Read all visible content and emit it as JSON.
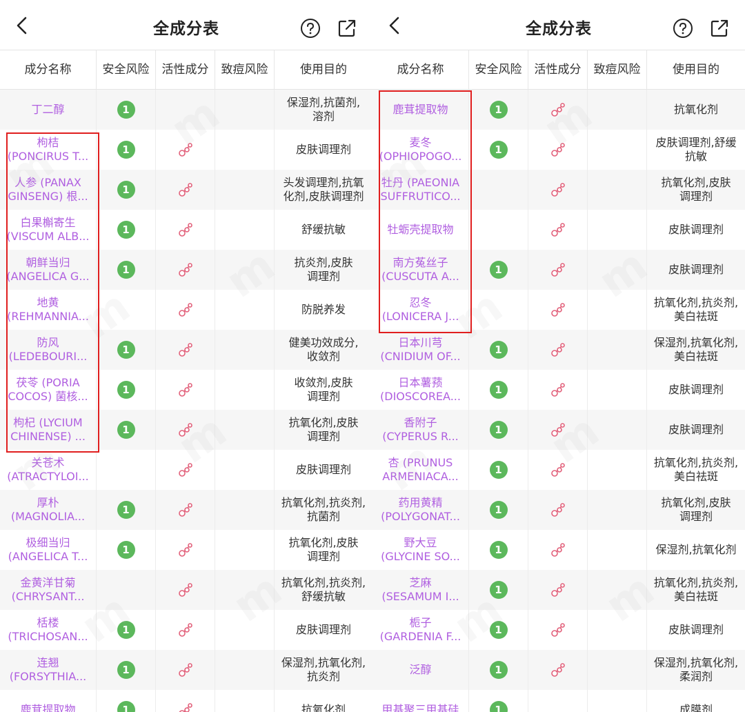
{
  "screen": {
    "title": "全成分表",
    "columns": [
      "成分名称",
      "安全风险",
      "活性成分",
      "致痘风险",
      "使用目的"
    ]
  },
  "colors": {
    "name_text": "#b05fe0",
    "risk_badge": "#5cb85c",
    "highlight": "#e01e1e",
    "active_icon": "#e2607a"
  },
  "icons": {
    "back": "chevron-left-icon",
    "help": "question-circle-icon",
    "share": "share-icon",
    "active": "molecule-icon"
  },
  "panels": [
    {
      "rows": [
        {
          "name": [
            "丁二醇"
          ],
          "risk": "1",
          "active": false,
          "purpose": [
            "保湿剂,抗菌剂,",
            "溶剂"
          ]
        },
        {
          "name": [
            "枸桔",
            "(PONCIRUS T..."
          ],
          "risk": "1",
          "active": true,
          "purpose": [
            "皮肤调理剂"
          ]
        },
        {
          "name": [
            "人参 (PANAX",
            "GINSENG) 根..."
          ],
          "risk": "1",
          "active": true,
          "purpose": [
            "头发调理剂,抗氧",
            "化剂,皮肤调理剂"
          ]
        },
        {
          "name": [
            "白果槲寄生",
            "(VISCUM ALB..."
          ],
          "risk": "1",
          "active": true,
          "purpose": [
            "舒缓抗敏"
          ]
        },
        {
          "name": [
            "朝鲜当归",
            "(ANGELICA G..."
          ],
          "risk": "1",
          "active": true,
          "purpose": [
            "抗炎剂,皮肤",
            "调理剂"
          ]
        },
        {
          "name": [
            "地黄",
            "(REHMANNIA..."
          ],
          "risk": "",
          "active": true,
          "purpose": [
            "防脱养发"
          ]
        },
        {
          "name": [
            "防风",
            "(LEDEBOURI..."
          ],
          "risk": "1",
          "active": true,
          "purpose": [
            "健美功效成分,",
            "收敛剂"
          ]
        },
        {
          "name": [
            "茯苓 (PORIA",
            "COCOS) 菌核..."
          ],
          "risk": "1",
          "active": true,
          "purpose": [
            "收敛剂,皮肤",
            "调理剂"
          ]
        },
        {
          "name": [
            "枸杞 (LYCIUM",
            "CHINENSE) ..."
          ],
          "risk": "1",
          "active": true,
          "purpose": [
            "抗氧化剂,皮肤",
            "调理剂"
          ]
        },
        {
          "name": [
            "关苍术",
            "(ATRACTYLOI..."
          ],
          "risk": "",
          "active": true,
          "purpose": [
            "皮肤调理剂"
          ]
        },
        {
          "name": [
            "厚朴",
            "(MAGNOLIA..."
          ],
          "risk": "1",
          "active": true,
          "purpose": [
            "抗氧化剂,抗炎剂,",
            "抗菌剂"
          ]
        },
        {
          "name": [
            "极细当归",
            "(ANGELICA T..."
          ],
          "risk": "1",
          "active": true,
          "purpose": [
            "抗氧化剂,皮肤",
            "调理剂"
          ]
        },
        {
          "name": [
            "金黄洋甘菊",
            "(CHRYSANT..."
          ],
          "risk": "",
          "active": true,
          "purpose": [
            "抗氧化剂,抗炎剂,",
            "舒缓抗敏"
          ]
        },
        {
          "name": [
            "栝楼",
            "(TRICHOSAN..."
          ],
          "risk": "1",
          "active": true,
          "purpose": [
            "皮肤调理剂"
          ]
        },
        {
          "name": [
            "连翘",
            "(FORSYTHIA..."
          ],
          "risk": "1",
          "active": true,
          "purpose": [
            "保湿剂,抗氧化剂,",
            "抗炎剂"
          ]
        },
        {
          "name": [
            "鹿茸提取物"
          ],
          "risk": "1",
          "active": true,
          "purpose": [
            "抗氧化剂"
          ]
        }
      ]
    },
    {
      "rows": [
        {
          "name": [
            "鹿茸提取物"
          ],
          "risk": "1",
          "active": true,
          "purpose": [
            "抗氧化剂"
          ]
        },
        {
          "name": [
            "麦冬",
            "(OPHIOPOGO..."
          ],
          "risk": "1",
          "active": true,
          "purpose": [
            "皮肤调理剂,舒缓",
            "抗敏"
          ]
        },
        {
          "name": [
            "牡丹 (PAEONIA",
            "SUFFRUTICO..."
          ],
          "risk": "",
          "active": true,
          "purpose": [
            "抗氧化剂,皮肤",
            "调理剂"
          ]
        },
        {
          "name": [
            "牡蛎壳提取物"
          ],
          "risk": "",
          "active": true,
          "purpose": [
            "皮肤调理剂"
          ]
        },
        {
          "name": [
            "南方菟丝子",
            "(CUSCUTA A..."
          ],
          "risk": "1",
          "active": true,
          "purpose": [
            "皮肤调理剂"
          ]
        },
        {
          "name": [
            "忍冬",
            "(LONICERA J..."
          ],
          "risk": "",
          "active": true,
          "purpose": [
            "抗氧化剂,抗炎剂,",
            "美白祛斑"
          ]
        },
        {
          "name": [
            "日本川芎",
            "(CNIDIUM OF..."
          ],
          "risk": "1",
          "active": true,
          "purpose": [
            "保湿剂,抗氧化剂,",
            "美白祛斑"
          ]
        },
        {
          "name": [
            "日本薯蓣",
            "(DIOSCOREA..."
          ],
          "risk": "1",
          "active": true,
          "purpose": [
            "皮肤调理剂"
          ]
        },
        {
          "name": [
            "香附子",
            "(CYPERUS R..."
          ],
          "risk": "1",
          "active": true,
          "purpose": [
            "皮肤调理剂"
          ]
        },
        {
          "name": [
            "杏 (PRUNUS",
            "ARMENIACA..."
          ],
          "risk": "1",
          "active": true,
          "purpose": [
            "抗氧化剂,抗炎剂,",
            "美白祛斑"
          ]
        },
        {
          "name": [
            "药用黄精",
            "(POLYGONAT..."
          ],
          "risk": "1",
          "active": true,
          "purpose": [
            "抗氧化剂,皮肤",
            "调理剂"
          ]
        },
        {
          "name": [
            "野大豆",
            "(GLYCINE SO..."
          ],
          "risk": "1",
          "active": true,
          "purpose": [
            "保湿剂,抗氧化剂"
          ]
        },
        {
          "name": [
            "芝麻",
            "(SESAMUM I..."
          ],
          "risk": "1",
          "active": true,
          "purpose": [
            "抗氧化剂,抗炎剂,",
            "美白祛斑"
          ]
        },
        {
          "name": [
            "栀子",
            "(GARDENIA F..."
          ],
          "risk": "1",
          "active": true,
          "purpose": [
            "皮肤调理剂"
          ]
        },
        {
          "name": [
            "泛醇"
          ],
          "risk": "1",
          "active": true,
          "purpose": [
            "保湿剂,抗氧化剂,",
            "柔润剂"
          ]
        },
        {
          "name": [
            "甲基聚三甲基硅"
          ],
          "risk": "1",
          "active": false,
          "purpose": [
            "成膜剂"
          ]
        }
      ]
    }
  ]
}
